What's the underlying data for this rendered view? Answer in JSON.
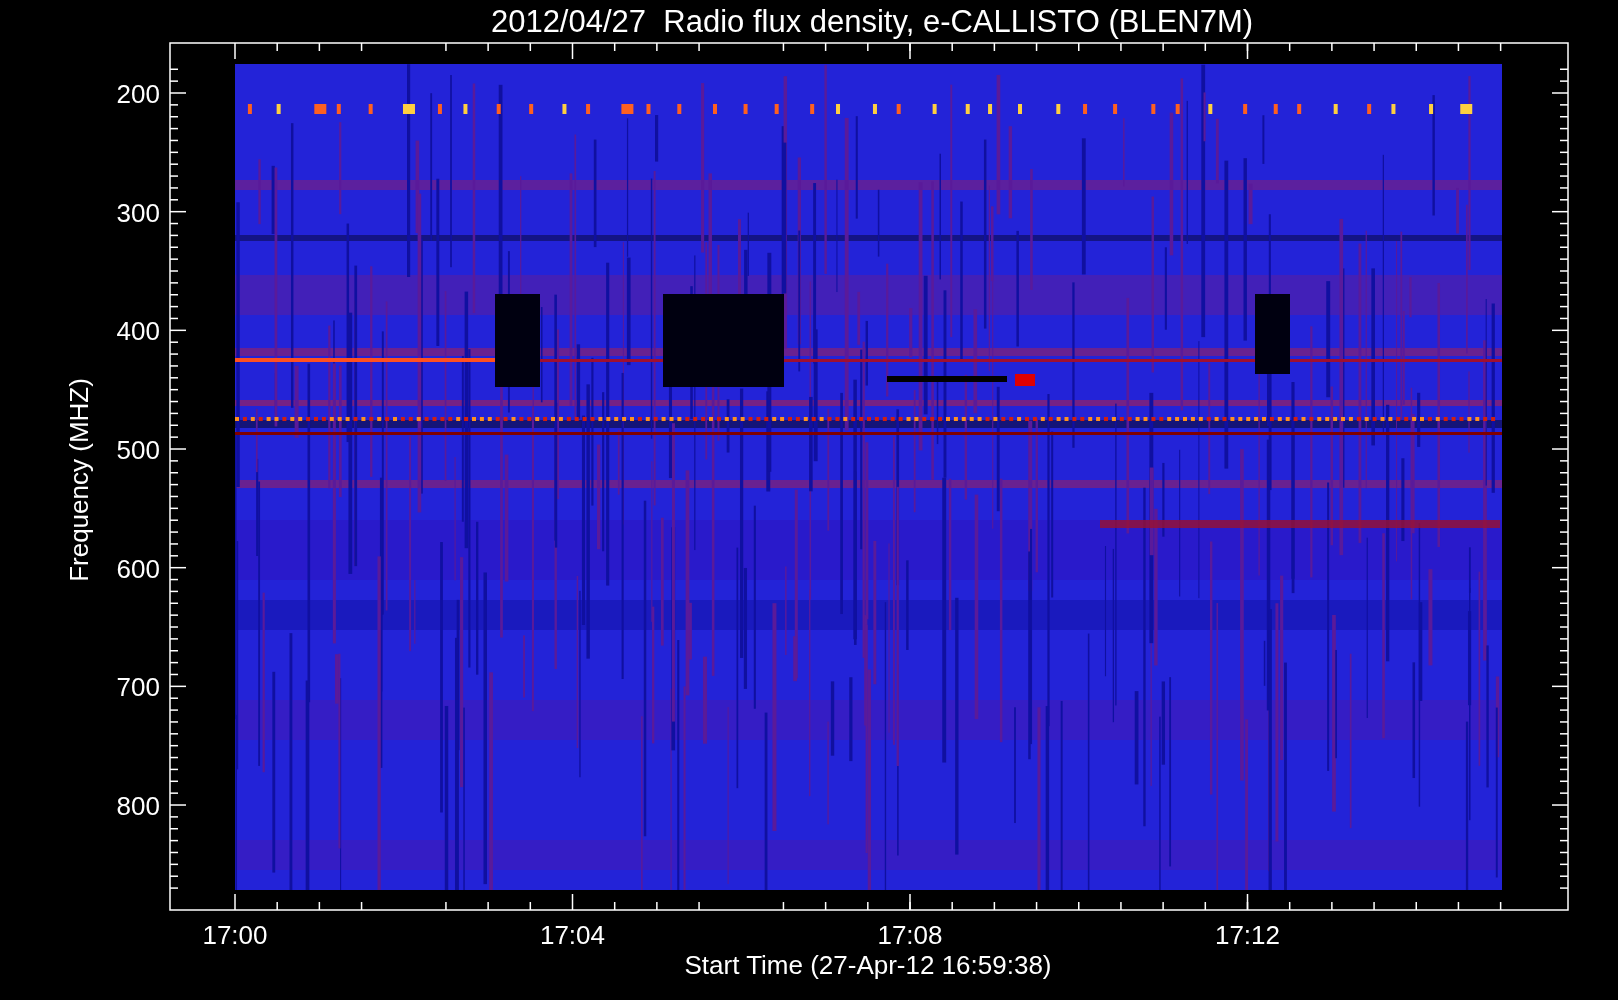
{
  "title": "2012/04/27  Radio flux density, e-CALLISTO (BLEN7M)",
  "y_axis": {
    "label": "Frequency (MHZ)",
    "ticks": [
      "200",
      "300",
      "400",
      "500",
      "600",
      "700",
      "800"
    ]
  },
  "x_axis": {
    "label": "Start Time (27-Apr-12 16:59:38)",
    "ticks": [
      "17:00",
      "17:04",
      "17:08",
      "17:12"
    ]
  }
}
